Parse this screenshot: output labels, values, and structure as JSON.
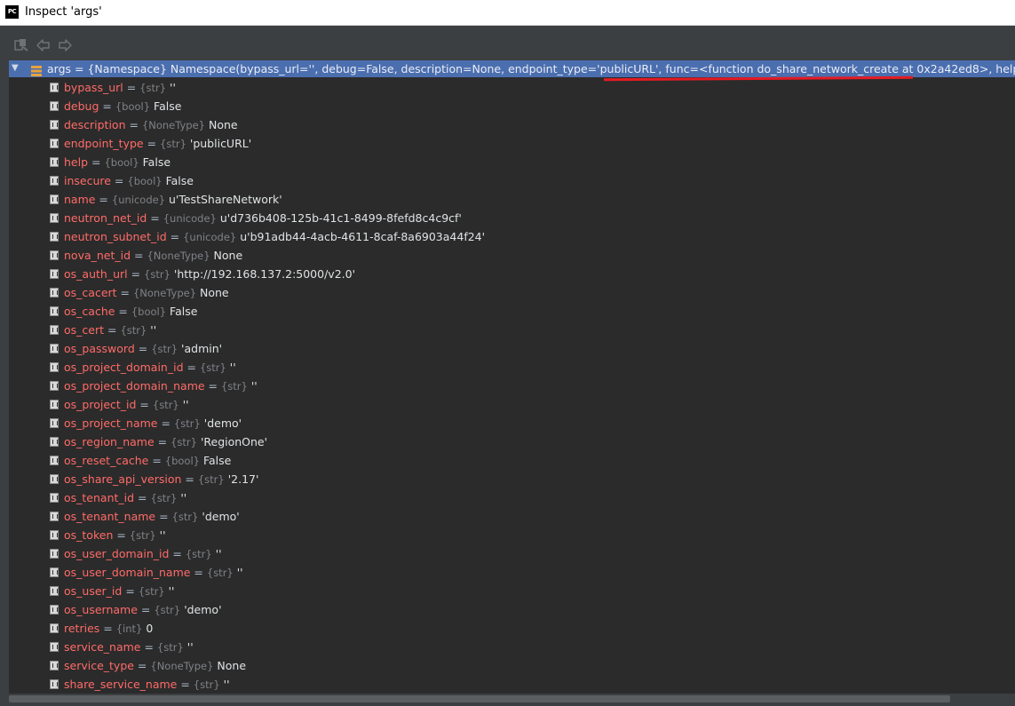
{
  "window": {
    "title": "Inspect 'args'",
    "logo_text": "PC"
  },
  "toolbar": {
    "buttons": [
      "restore-layout-icon",
      "back-arrow-icon",
      "forward-arrow-icon"
    ]
  },
  "tree": {
    "root": {
      "text": "args = {Namespace} Namespace(bypass_url='', debug=False, description=None, endpoint_type='publicURL', func=<function do_share_network_create at 0x2a42ed8>, help=False, insecure=False, name=u'TestShareNetwork', neutron_net_id=u'd736b408-125b-41c1-8499-8fefd8c4c9cf'",
      "expanded": true
    },
    "children": [
      {
        "name": "bypass_url",
        "type": "{str}",
        "value": "''"
      },
      {
        "name": "debug",
        "type": "{bool}",
        "value": "False"
      },
      {
        "name": "description",
        "type": "{NoneType}",
        "value": "None"
      },
      {
        "name": "endpoint_type",
        "type": "{str}",
        "value": "'publicURL'"
      },
      {
        "name": "help",
        "type": "{bool}",
        "value": "False"
      },
      {
        "name": "insecure",
        "type": "{bool}",
        "value": "False"
      },
      {
        "name": "name",
        "type": "{unicode}",
        "value": "u'TestShareNetwork'"
      },
      {
        "name": "neutron_net_id",
        "type": "{unicode}",
        "value": "u'd736b408-125b-41c1-8499-8fefd8c4c9cf'"
      },
      {
        "name": "neutron_subnet_id",
        "type": "{unicode}",
        "value": "u'b91adb44-4acb-4611-8caf-8a6903a44f24'"
      },
      {
        "name": "nova_net_id",
        "type": "{NoneType}",
        "value": "None"
      },
      {
        "name": "os_auth_url",
        "type": "{str}",
        "value": "'http://192.168.137.2:5000/v2.0'"
      },
      {
        "name": "os_cacert",
        "type": "{NoneType}",
        "value": "None"
      },
      {
        "name": "os_cache",
        "type": "{bool}",
        "value": "False"
      },
      {
        "name": "os_cert",
        "type": "{str}",
        "value": "''"
      },
      {
        "name": "os_password",
        "type": "{str}",
        "value": "'admin'"
      },
      {
        "name": "os_project_domain_id",
        "type": "{str}",
        "value": "''"
      },
      {
        "name": "os_project_domain_name",
        "type": "{str}",
        "value": "''"
      },
      {
        "name": "os_project_id",
        "type": "{str}",
        "value": "''"
      },
      {
        "name": "os_project_name",
        "type": "{str}",
        "value": "'demo'"
      },
      {
        "name": "os_region_name",
        "type": "{str}",
        "value": "'RegionOne'"
      },
      {
        "name": "os_reset_cache",
        "type": "{bool}",
        "value": "False"
      },
      {
        "name": "os_share_api_version",
        "type": "{str}",
        "value": "'2.17'"
      },
      {
        "name": "os_tenant_id",
        "type": "{str}",
        "value": "''"
      },
      {
        "name": "os_tenant_name",
        "type": "{str}",
        "value": "'demo'"
      },
      {
        "name": "os_token",
        "type": "{str}",
        "value": "''"
      },
      {
        "name": "os_user_domain_id",
        "type": "{str}",
        "value": "''"
      },
      {
        "name": "os_user_domain_name",
        "type": "{str}",
        "value": "''"
      },
      {
        "name": "os_user_id",
        "type": "{str}",
        "value": "''"
      },
      {
        "name": "os_username",
        "type": "{str}",
        "value": "'demo'"
      },
      {
        "name": "retries",
        "type": "{int}",
        "value": "0"
      },
      {
        "name": "service_name",
        "type": "{str}",
        "value": "''"
      },
      {
        "name": "service_type",
        "type": "{NoneType}",
        "value": "None"
      },
      {
        "name": "share_service_name",
        "type": "{str}",
        "value": "''"
      }
    ]
  },
  "colors": {
    "background": "#2b2b2b",
    "selection": "#4b6eaf",
    "field_name": "#ff6b68",
    "type_hint": "#7f8287",
    "annotation_underline": "#e41b23"
  }
}
